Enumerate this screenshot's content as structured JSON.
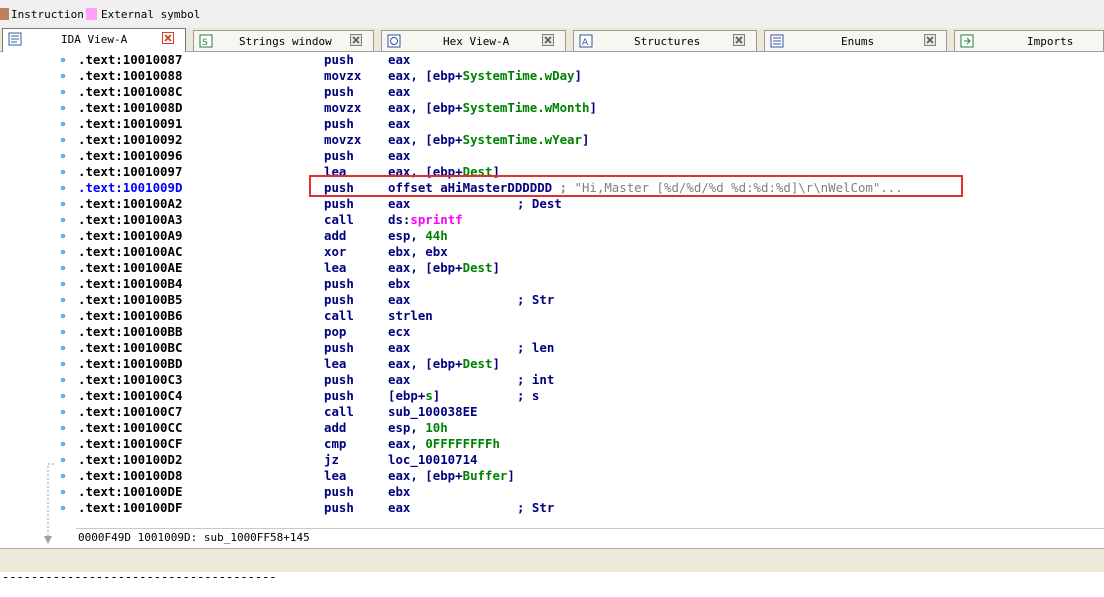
{
  "legend": {
    "items": [
      {
        "label": "Instruction",
        "color": "#c08060"
      },
      {
        "label": "External symbol",
        "color": "#ffa0ff"
      }
    ]
  },
  "tabs": [
    {
      "label": "IDA View-A",
      "icon": "ida-view-icon",
      "active": true
    },
    {
      "label": "Strings window",
      "icon": "strings-icon",
      "active": false
    },
    {
      "label": "Hex View-A",
      "icon": "hex-view-icon",
      "active": false
    },
    {
      "label": "Structures",
      "icon": "structures-icon",
      "active": false
    },
    {
      "label": "Enums",
      "icon": "enums-icon",
      "active": false
    },
    {
      "label": "Imports",
      "icon": "imports-icon",
      "active": false
    }
  ],
  "code": {
    "highlight_address": ".text:1001009D",
    "lines": [
      {
        "addr": ".text:10010087",
        "mn": "push",
        "op": [
          [
            "eax",
            ""
          ]
        ]
      },
      {
        "addr": ".text:10010088",
        "mn": "movzx",
        "op": [
          [
            "eax, [ebp+",
            ""
          ],
          [
            "SystemTime.wDay",
            "stk"
          ],
          [
            "]",
            ""
          ]
        ]
      },
      {
        "addr": ".text:1001008C",
        "mn": "push",
        "op": [
          [
            "eax",
            ""
          ]
        ]
      },
      {
        "addr": ".text:1001008D",
        "mn": "movzx",
        "op": [
          [
            "eax, [ebp+",
            ""
          ],
          [
            "SystemTime.wMonth",
            "stk"
          ],
          [
            "]",
            ""
          ]
        ]
      },
      {
        "addr": ".text:10010091",
        "mn": "push",
        "op": [
          [
            "eax",
            ""
          ]
        ]
      },
      {
        "addr": ".text:10010092",
        "mn": "movzx",
        "op": [
          [
            "eax, [ebp+",
            ""
          ],
          [
            "SystemTime.wYear",
            "stk"
          ],
          [
            "]",
            ""
          ]
        ]
      },
      {
        "addr": ".text:10010096",
        "mn": "push",
        "op": [
          [
            "eax",
            ""
          ]
        ]
      },
      {
        "addr": ".text:10010097",
        "mn": "lea",
        "op": [
          [
            "eax, [ebp+",
            ""
          ],
          [
            "Dest",
            "stk"
          ],
          [
            "]",
            ""
          ]
        ]
      },
      {
        "addr": ".text:1001009D",
        "mn": "push",
        "op": [
          [
            "offset aHiMasterDDDDDD ",
            ""
          ],
          [
            "; ",
            "sc"
          ],
          [
            "\"Hi,Master [%d/%d/%d %d:%d:%d]\\r\\nWelCom\"...",
            "strc"
          ]
        ]
      },
      {
        "addr": ".text:100100A2",
        "mn": "push",
        "op": [
          [
            "eax",
            ""
          ]
        ],
        "cm": "; Dest"
      },
      {
        "addr": ".text:100100A3",
        "mn": "call",
        "op": [
          [
            "ds:",
            ""
          ],
          [
            "sprintf",
            "imp"
          ]
        ]
      },
      {
        "addr": ".text:100100A9",
        "mn": "add",
        "op": [
          [
            "esp, ",
            ""
          ],
          [
            "44h",
            "num"
          ]
        ]
      },
      {
        "addr": ".text:100100AC",
        "mn": "xor",
        "op": [
          [
            "ebx, ebx",
            ""
          ]
        ]
      },
      {
        "addr": ".text:100100AE",
        "mn": "lea",
        "op": [
          [
            "eax, [ebp+",
            ""
          ],
          [
            "Dest",
            "stk"
          ],
          [
            "]",
            ""
          ]
        ]
      },
      {
        "addr": ".text:100100B4",
        "mn": "push",
        "op": [
          [
            "ebx",
            ""
          ]
        ]
      },
      {
        "addr": ".text:100100B5",
        "mn": "push",
        "op": [
          [
            "eax",
            ""
          ]
        ],
        "cm": "; Str"
      },
      {
        "addr": ".text:100100B6",
        "mn": "call",
        "op": [
          [
            "strlen",
            ""
          ]
        ]
      },
      {
        "addr": ".text:100100BB",
        "mn": "pop",
        "op": [
          [
            "ecx",
            ""
          ]
        ]
      },
      {
        "addr": ".text:100100BC",
        "mn": "push",
        "op": [
          [
            "eax",
            ""
          ]
        ],
        "cm": "; len"
      },
      {
        "addr": ".text:100100BD",
        "mn": "lea",
        "op": [
          [
            "eax, [ebp+",
            ""
          ],
          [
            "Dest",
            "stk"
          ],
          [
            "]",
            ""
          ]
        ]
      },
      {
        "addr": ".text:100100C3",
        "mn": "push",
        "op": [
          [
            "eax",
            ""
          ]
        ],
        "cm": "; int"
      },
      {
        "addr": ".text:100100C4",
        "mn": "push",
        "op": [
          [
            "[ebp+",
            ""
          ],
          [
            "s",
            "stk"
          ],
          [
            "]",
            ""
          ]
        ],
        "cm": "; s"
      },
      {
        "addr": ".text:100100C7",
        "mn": "call",
        "op": [
          [
            "sub_100038EE",
            ""
          ]
        ]
      },
      {
        "addr": ".text:100100CC",
        "mn": "add",
        "op": [
          [
            "esp, ",
            ""
          ],
          [
            "10h",
            "num"
          ]
        ]
      },
      {
        "addr": ".text:100100CF",
        "mn": "cmp",
        "op": [
          [
            "eax, ",
            ""
          ],
          [
            "0FFFFFFFFh",
            "num"
          ]
        ]
      },
      {
        "addr": ".text:100100D2",
        "mn": "jz",
        "op": [
          [
            "loc_10010714",
            ""
          ]
        ]
      },
      {
        "addr": ".text:100100D8",
        "mn": "lea",
        "op": [
          [
            "eax, [ebp+",
            ""
          ],
          [
            "Buffer",
            "stk"
          ],
          [
            "]",
            ""
          ]
        ]
      },
      {
        "addr": ".text:100100DE",
        "mn": "push",
        "op": [
          [
            "ebx",
            ""
          ]
        ]
      },
      {
        "addr": ".text:100100DF",
        "mn": "push",
        "op": [
          [
            "eax",
            ""
          ]
        ],
        "cm": "; Str"
      }
    ]
  },
  "status": {
    "text": "0000F49D 1001009D: sub_1000FF58+145"
  },
  "bottom": {
    "dashes": "--------------------------------------"
  }
}
